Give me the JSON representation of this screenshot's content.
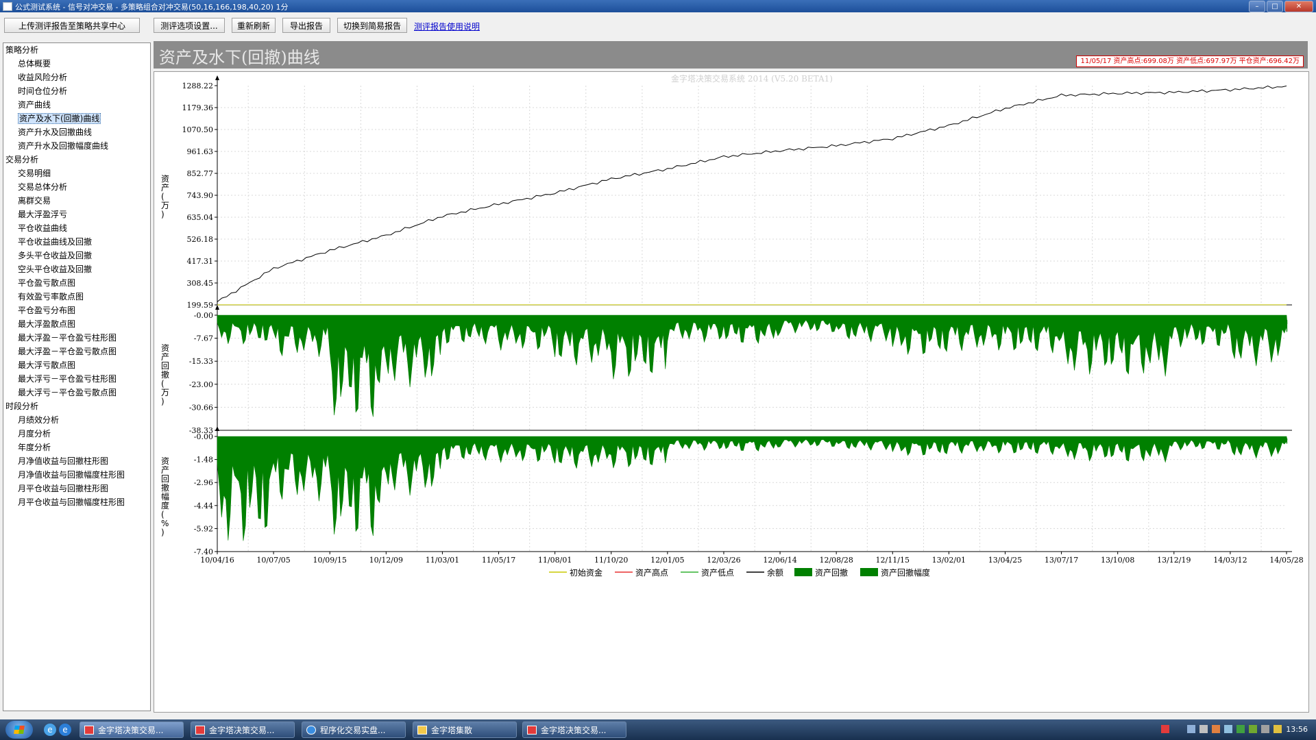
{
  "window": {
    "title": "公式测试系统 - 信号对冲交易 - 多策略组合对冲交易(50,16,166,198,40,20) 1分"
  },
  "toolbar": {
    "upload_label": "上传测评报告至策略共享中心",
    "settings_label": "测评选项设置...",
    "refresh_label": "重新刷新",
    "export_label": "导出报告",
    "switch_label": "切换到简易报告",
    "help_link": "测评报告使用说明"
  },
  "sidebar": {
    "groups": [
      {
        "label": "策略分析",
        "items": [
          "总体概要",
          "收益风险分析",
          "时间仓位分析",
          "资产曲线",
          "资产及水下(回撤)曲线",
          "资产升水及回撤曲线",
          "资产升水及回撤幅度曲线"
        ]
      },
      {
        "label": "交易分析",
        "items": [
          "交易明细",
          "交易总体分析",
          "离群交易",
          "最大浮盈浮亏",
          "平仓收益曲线",
          "平仓收益曲线及回撤",
          "多头平仓收益及回撤",
          "空头平仓收益及回撤",
          "平仓盈亏散点图",
          "有效盈亏率散点图",
          "平仓盈亏分布图",
          "最大浮盈散点图",
          "最大浮盈－平仓盈亏柱形图",
          "最大浮盈－平仓盈亏散点图",
          "最大浮亏散点图",
          "最大浮亏－平仓盈亏柱形图",
          "最大浮亏－平仓盈亏散点图"
        ]
      },
      {
        "label": "时段分析",
        "items": [
          "月绩效分析",
          "月度分析",
          "年度分析",
          "月净值收益与回撤柱形图",
          "月净值收益与回撤幅度柱形图",
          "月平仓收益与回撤柱形图",
          "月平仓收益与回撤幅度柱形图"
        ]
      }
    ],
    "selected": "资产及水下(回撤)曲线"
  },
  "report": {
    "title": "资产及水下(回撤)曲线",
    "stats": "11/05/17 资产高点:699.08万  资产低点:697.97万  平仓资产:696.42万"
  },
  "chart_data": [
    {
      "type": "line",
      "watermark": "金字塔决策交易系统 2014 (V5.20 BETA1)",
      "ylabel": "资产(万)",
      "y_ticks": [
        "1288.22",
        "1179.36",
        "1070.50",
        "961.63",
        "852.77",
        "743.90",
        "635.04",
        "526.18",
        "417.31",
        "308.45",
        "199.59"
      ],
      "ylim": [
        199.59,
        1288.22
      ],
      "x_ticks": [
        "10/04/16",
        "10/07/05",
        "10/09/15",
        "10/12/09",
        "11/03/01",
        "11/05/17",
        "11/08/01",
        "11/10/20",
        "12/01/05",
        "12/03/26",
        "12/06/14",
        "12/08/28",
        "12/11/15",
        "13/02/01",
        "13/04/25",
        "13/07/17",
        "13/10/08",
        "13/12/19",
        "14/03/12",
        "14/05/28"
      ],
      "series": [
        {
          "name": "初始资金",
          "color": "#c8c800",
          "values": [
            200,
            200,
            200,
            200,
            200,
            200,
            200,
            200,
            200,
            200,
            200,
            200,
            200,
            200,
            200,
            200,
            200,
            200,
            200,
            200
          ]
        },
        {
          "name": "余额",
          "color": "#000000",
          "values": [
            215,
            380,
            470,
            545,
            640,
            700,
            755,
            825,
            875,
            935,
            965,
            990,
            1025,
            1090,
            1175,
            1240,
            1250,
            1255,
            1268,
            1285
          ]
        }
      ]
    },
    {
      "type": "area",
      "ylabel": "资产回撤(万)",
      "y_ticks": [
        "-0.00",
        "-7.67",
        "-15.33",
        "-23.00",
        "-30.66",
        "-38.33"
      ],
      "ylim": [
        -38.33,
        0
      ],
      "series": [
        {
          "name": "资产回撤",
          "color": "#008000",
          "min_values": [
            -10,
            -14,
            -36,
            -24,
            -10,
            -12,
            -17,
            -22,
            -9,
            -10,
            -6,
            -9,
            -14,
            -12,
            -13,
            -20,
            -21,
            -11,
            -17,
            -6
          ]
        }
      ]
    },
    {
      "type": "area",
      "ylabel": "资产回撤幅度(%)",
      "y_ticks": [
        "-0.00",
        "-1.48",
        "-2.96",
        "-4.44",
        "-5.92",
        "-7.40"
      ],
      "ylim": [
        -7.4,
        0
      ],
      "series": [
        {
          "name": "资产回撤幅度",
          "color": "#008000",
          "min_values": [
            -7.0,
            -4.2,
            -6.8,
            -3.8,
            -1.6,
            -1.7,
            -2.1,
            -2.1,
            -0.9,
            -1.0,
            -0.7,
            -0.9,
            -1.3,
            -1.1,
            -1.2,
            -1.6,
            -1.7,
            -0.9,
            -1.4,
            -0.5
          ]
        }
      ]
    }
  ],
  "legend": [
    {
      "label": "初始资金",
      "color": "#c8c800",
      "kind": "line"
    },
    {
      "label": "资产高点",
      "color": "#e83030",
      "kind": "line"
    },
    {
      "label": "资产低点",
      "color": "#30b030",
      "kind": "line"
    },
    {
      "label": "余额",
      "color": "#000000",
      "kind": "line"
    },
    {
      "label": "资产回撤",
      "color": "#008000",
      "kind": "box"
    },
    {
      "label": "资产回撤幅度",
      "color": "#008000",
      "kind": "box"
    }
  ],
  "taskbar": {
    "tasks": [
      {
        "label": "金字塔决策交易...",
        "icon": "app-icon",
        "active": true
      },
      {
        "label": "金字塔决策交易...",
        "icon": "app-icon",
        "active": false
      },
      {
        "label": "程序化交易实盘...",
        "icon": "ie-icon",
        "active": false
      },
      {
        "label": "金字塔集散",
        "icon": "folder-icon",
        "active": false
      },
      {
        "label": "金字塔决策交易...",
        "icon": "app-icon",
        "active": false
      }
    ],
    "clock": "13:56"
  }
}
